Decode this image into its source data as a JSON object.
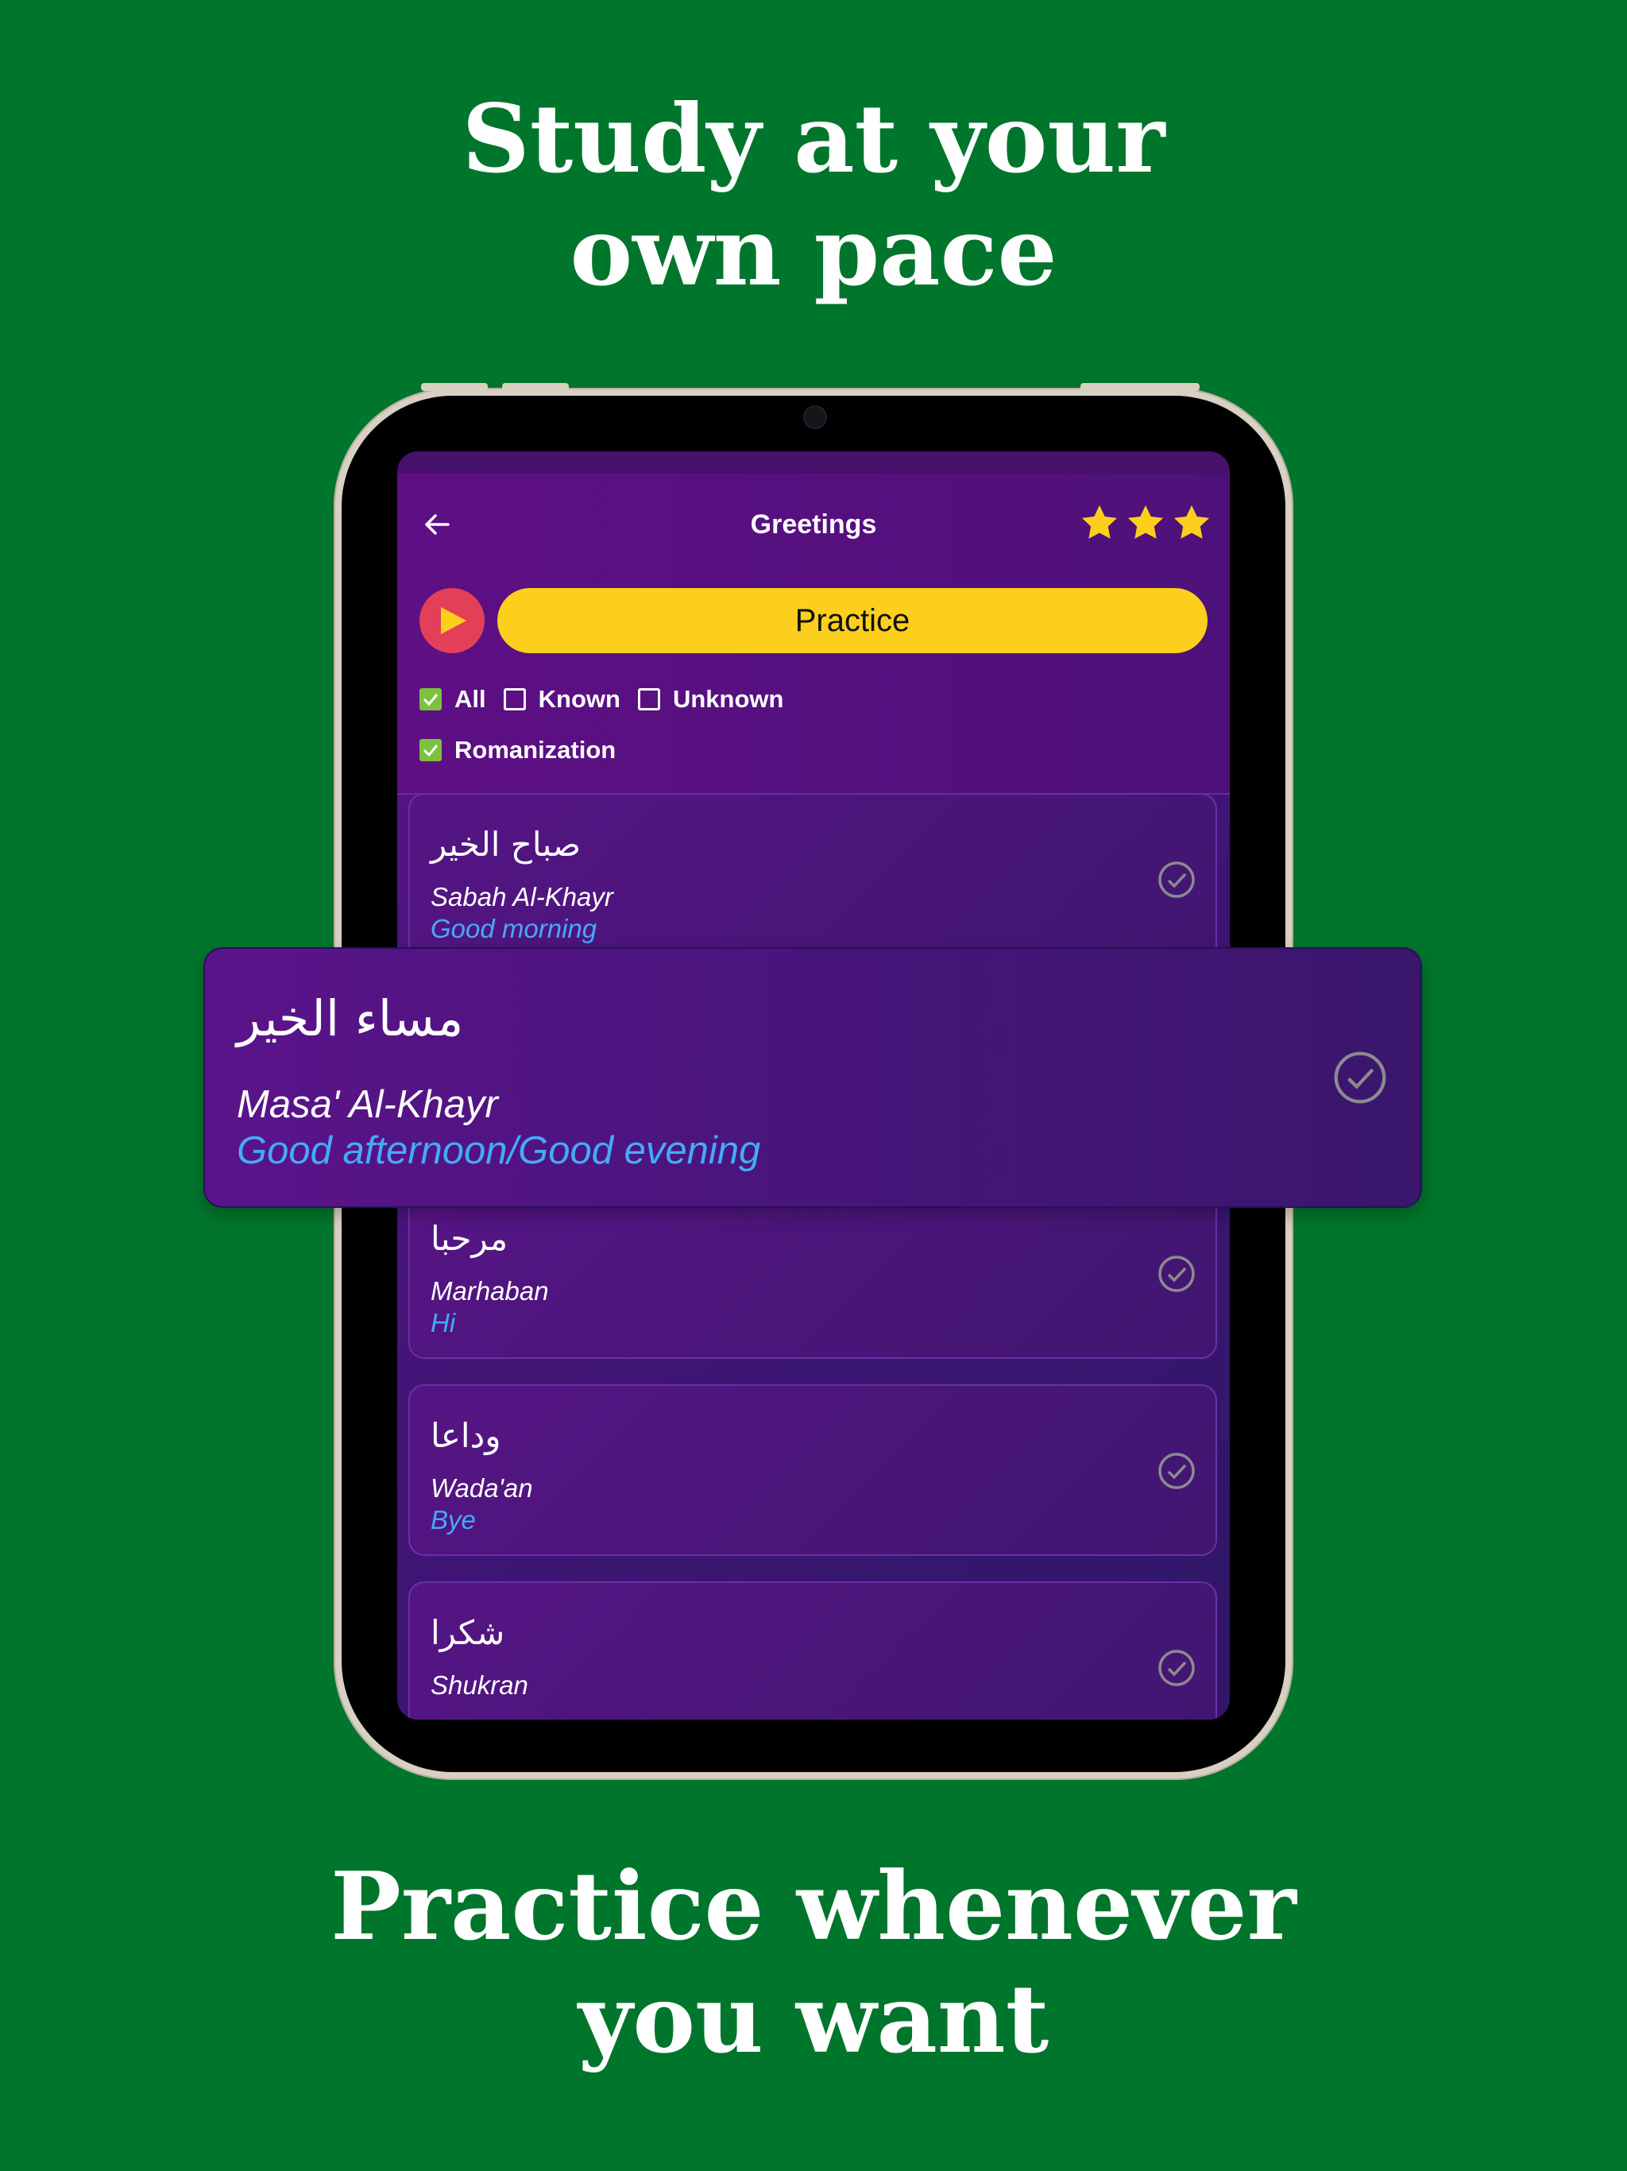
{
  "headline_top": [
    "Study at your",
    "own pace"
  ],
  "headline_bottom": [
    "Practice whenever",
    "you want"
  ],
  "app": {
    "title": "Greetings",
    "stars": 3,
    "practice_label": "Practice",
    "filters": {
      "all": "All",
      "known": "Known",
      "unknown": "Unknown",
      "romanization": "Romanization"
    },
    "filter_state": {
      "all": true,
      "known": false,
      "unknown": false,
      "romanization": true
    }
  },
  "phrases": [
    {
      "arabic": "صباح الخير",
      "roman": "Sabah Al-Khayr",
      "translation": "Good morning"
    },
    {
      "arabic": "مرحبا",
      "roman": "Marhaban",
      "translation": "Hi"
    },
    {
      "arabic": "وداعا",
      "roman": "Wada'an",
      "translation": "Bye"
    },
    {
      "arabic": "شكرا",
      "roman": "Shukran",
      "translation": ""
    }
  ],
  "featured": {
    "arabic": "مساء الخير",
    "roman": "Masa' Al-Khayr",
    "translation": "Good afternoon/Good evening"
  },
  "colors": {
    "background": "#00752c",
    "accent_yellow": "#fbcf1c",
    "play_red": "#e34057",
    "translation_blue": "#45aaf7",
    "checkbox_green": "#7cc140"
  }
}
